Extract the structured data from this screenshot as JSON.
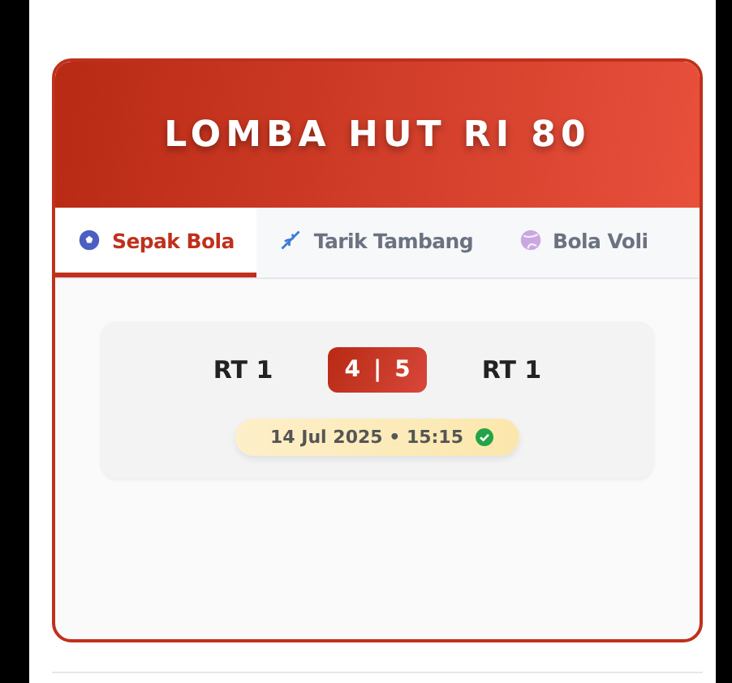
{
  "title": "LOMBA HUT RI 80",
  "tabs": [
    {
      "label": "Sepak Bola",
      "kind": "soccer",
      "selected": true
    },
    {
      "label": "Tarik Tambang",
      "kind": "rope",
      "selected": false
    },
    {
      "label": "Bola Voli",
      "kind": "volleyball",
      "selected": false
    }
  ],
  "matches": [
    {
      "team_home": "RT 1",
      "score_home": "4",
      "separator": "|",
      "score_away": "5",
      "team_away": "RT 1",
      "datetime": "14 Jul 2025 • 15:15",
      "finished": true
    }
  ]
}
